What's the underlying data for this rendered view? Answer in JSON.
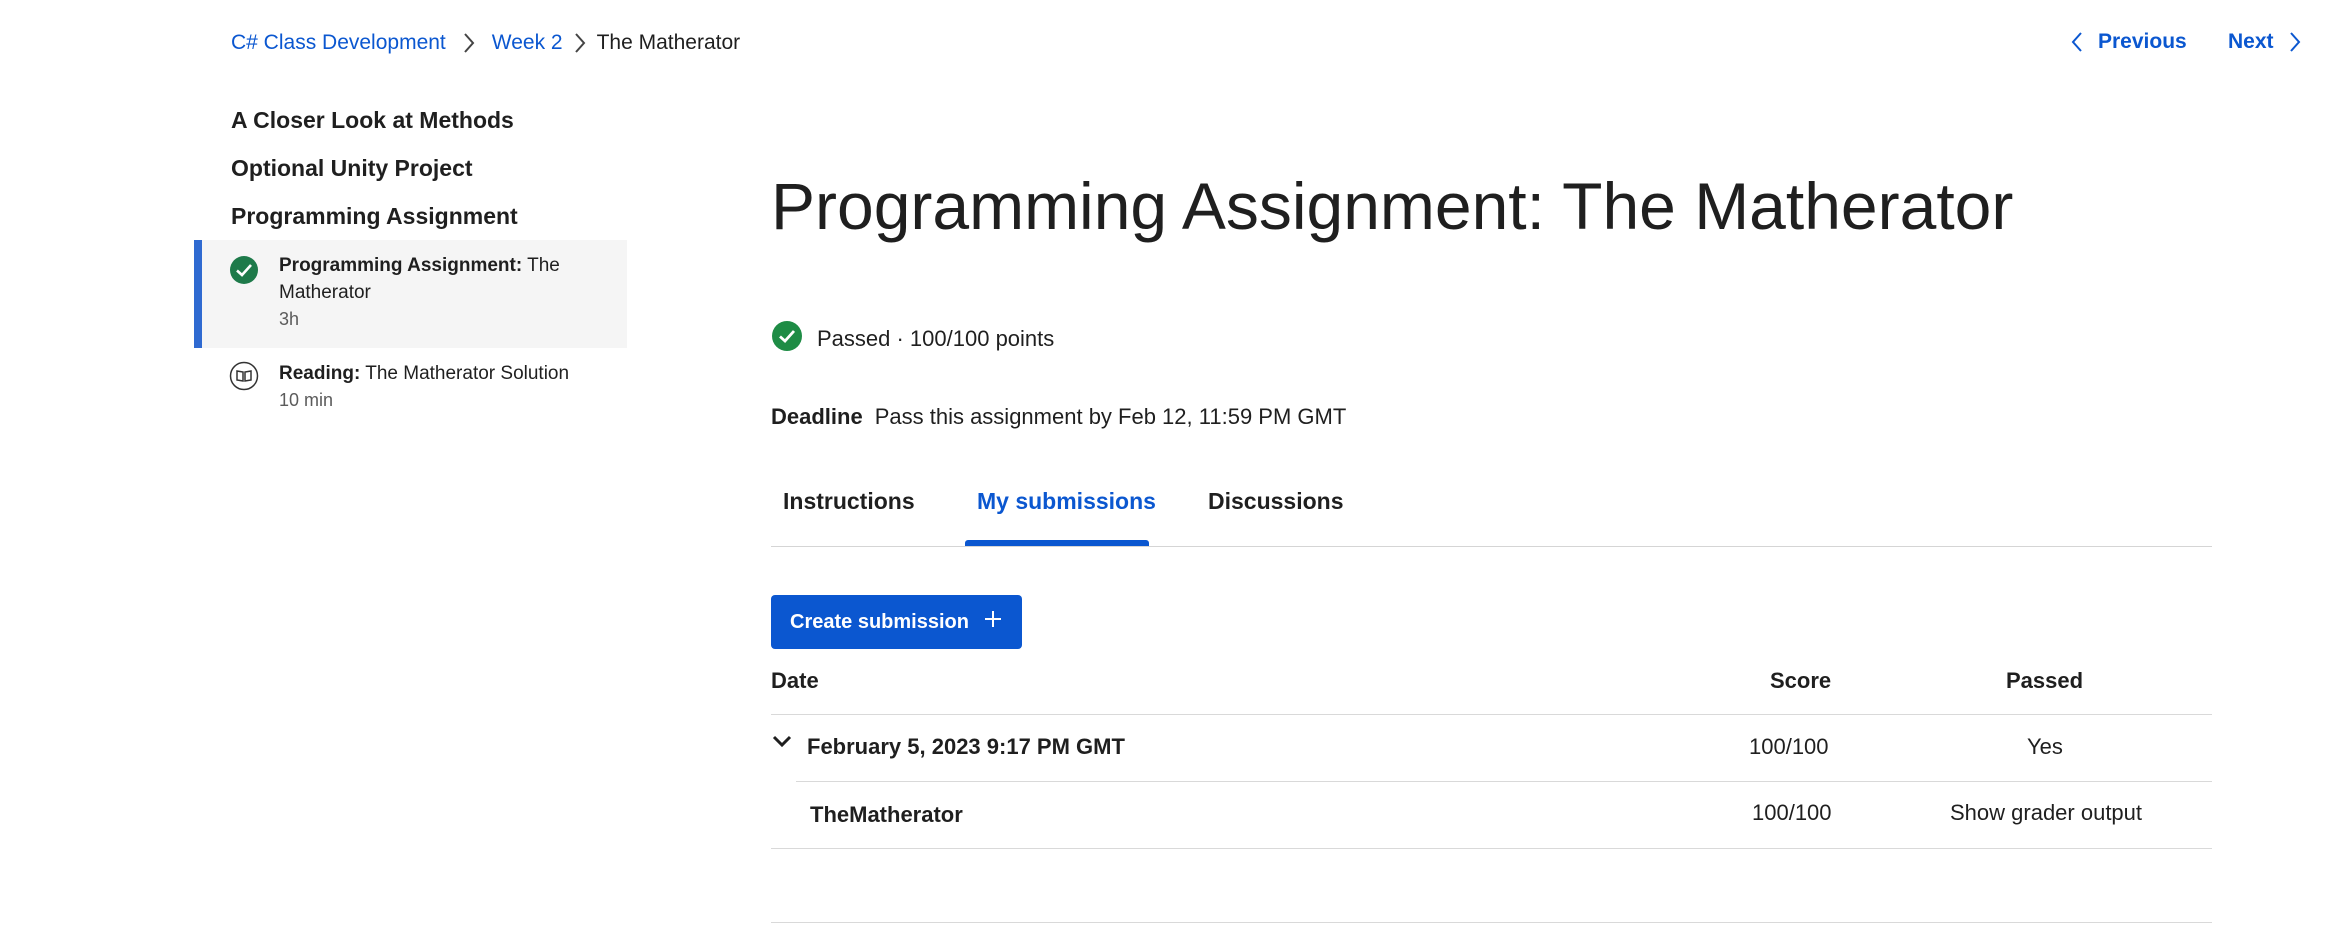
{
  "breadcrumb": {
    "items": [
      "C# Class Development",
      "Week 2"
    ],
    "current": "The Matherator"
  },
  "pager": {
    "previous": "Previous",
    "next": "Next"
  },
  "sidebar": {
    "headings": [
      "A Closer Look at Methods",
      "Optional Unity Project",
      "Programming Assignment"
    ],
    "items": [
      {
        "type": "Programming Assignment:",
        "name": "The Matherator",
        "duration": "3h",
        "icon": "check-circle-icon",
        "active": true
      },
      {
        "type": "Reading:",
        "name": "The Matherator Solution",
        "duration": "10 min",
        "icon": "book-icon",
        "active": false
      }
    ]
  },
  "main": {
    "title": "Programming Assignment: The Matherator",
    "status": "Passed · 100/100 points",
    "deadline_label": "Deadline",
    "deadline_text": "Pass this assignment by Feb 12, 11:59 PM GMT",
    "tabs": [
      {
        "label": "Instructions"
      },
      {
        "label": "My submissions"
      },
      {
        "label": "Discussions"
      }
    ],
    "selected_tab": "My submissions",
    "create_button": "Create submission"
  },
  "submissions": {
    "headers": {
      "date": "Date",
      "score": "Score",
      "passed": "Passed"
    },
    "rows": [
      {
        "date": "February 5, 2023 9:17 PM GMT",
        "score": "100/100",
        "passed": "Yes",
        "files": [
          {
            "name": "TheMatherator",
            "score": "100/100",
            "action": "Show grader output"
          }
        ]
      }
    ]
  },
  "colors": {
    "accent": "#0b57d0",
    "passed_green": "#1e8c45",
    "sidebar_active_bar": "#2f6ad1"
  }
}
